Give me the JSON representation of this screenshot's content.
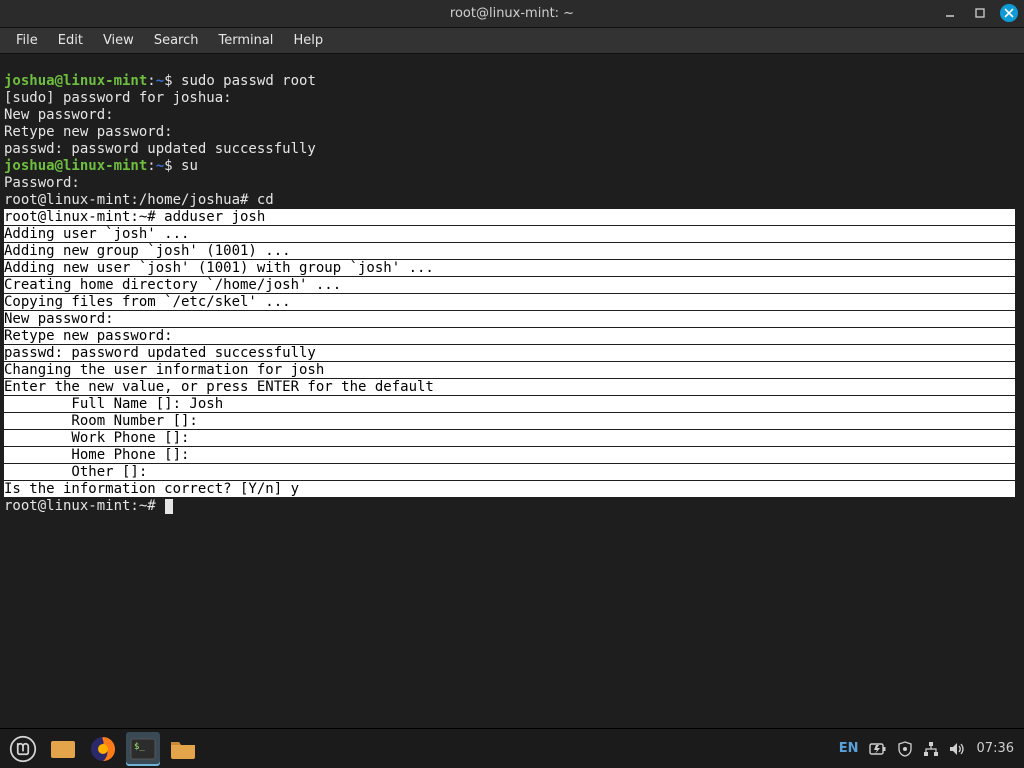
{
  "window": {
    "title": "root@linux-mint: ~",
    "controls": {
      "min": "–",
      "max": "□",
      "close": "✕"
    }
  },
  "menu": {
    "file": "File",
    "edit": "Edit",
    "view": "View",
    "search": "Search",
    "terminal": "Terminal",
    "help": "Help"
  },
  "term": {
    "p1_user": "joshua@linux-mint",
    "p1_sep": ":",
    "p1_path": "~",
    "p1_end": "$ ",
    "p1_cmd": "sudo passwd root",
    "l2": "[sudo] password for joshua: ",
    "l3": "New password: ",
    "l4": "Retype new password: ",
    "l5": "passwd: password updated successfully",
    "p2_cmd": "su",
    "l7": "Password: ",
    "l8_prompt": "root@linux-mint:/home/joshua# ",
    "l8_cmd": "cd",
    "sel_prompt": "root@linux-mint:~# ",
    "sel_cmd1": "adduser josh",
    "sel_l2": "Adding user `josh' ...",
    "sel_l3": "Adding new group `josh' (1001) ...",
    "sel_l4": "Adding new user `josh' (1001) with group `josh' ...",
    "sel_l5": "Creating home directory `/home/josh' ...",
    "sel_l6": "Copying files from `/etc/skel' ...",
    "sel_l7": "New password: ",
    "sel_l8": "Retype new password: ",
    "sel_l9": "passwd: password updated successfully",
    "sel_l10": "Changing the user information for josh",
    "sel_l11": "Enter the new value, or press ENTER for the default",
    "sel_l12": "        Full Name []: Josh",
    "sel_l13": "        Room Number []: ",
    "sel_l14": "        Work Phone []: ",
    "sel_l15": "        Home Phone []: ",
    "sel_l16": "        Other []: ",
    "sel_l17": "Is the information correct? [Y/n] y",
    "final_prompt": "root@linux-mint:~# "
  },
  "taskbar": {
    "lang": "EN",
    "clock": "07:36"
  },
  "colors": {
    "bg": "#1e1e1e",
    "prompt_user": "#6fbf3f",
    "prompt_path": "#3a6fcf",
    "selection_bg": "#ffffff",
    "selection_fg": "#000000",
    "panel": "#1b1b1b"
  }
}
